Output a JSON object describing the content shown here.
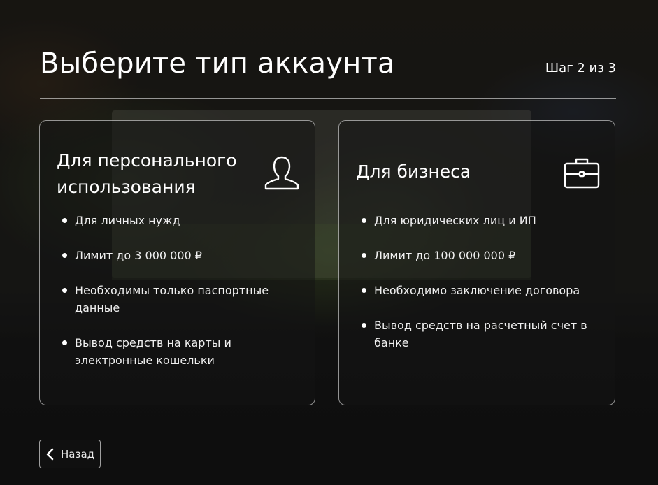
{
  "header": {
    "title": "Выберите тип аккаунта",
    "step": "Шаг 2 из 3"
  },
  "cards": [
    {
      "title_line1": "Для персонального",
      "title_line2": "использования",
      "icon": "user-icon",
      "features": [
        "Для личных нужд",
        "Лимит до 3 000 000 ₽",
        "Необходимы только паспортные данные",
        "Вывод средств на карты и электронные кошельки"
      ]
    },
    {
      "title_line1": "Для бизнеса",
      "icon": "briefcase-icon",
      "features": [
        "Для юридических лиц и ИП",
        "Лимит до 100 000 000 ₽",
        "Необходимо заключение договора",
        "Вывод средств на расчетный счет в банке"
      ]
    }
  ],
  "footer": {
    "back_label": "Назад",
    "back_icon": "chevron-left-icon"
  }
}
